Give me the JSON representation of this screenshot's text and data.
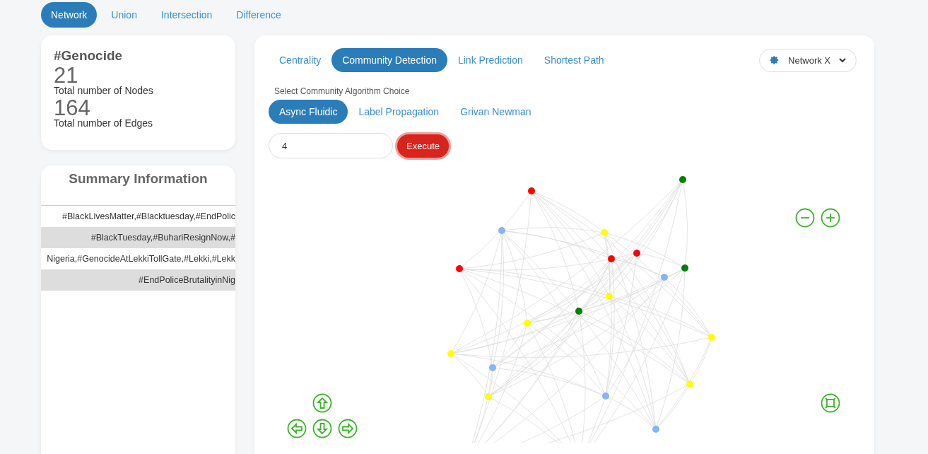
{
  "top_tabs": [
    {
      "label": "Network",
      "selected": true
    },
    {
      "label": "Union",
      "selected": false
    },
    {
      "label": "Intersection",
      "selected": false
    },
    {
      "label": "Difference",
      "selected": false
    }
  ],
  "stats": {
    "title": "#Genocide",
    "nodes_count": "21",
    "nodes_label": "Total number of Nodes",
    "edges_count": "164",
    "edges_label": "Total number of Edges"
  },
  "summary": {
    "title": "Summary Information",
    "rows": [
      {
        "text": "#BlackLivesMatter,#Blacktuesday,#EndPolic"
      },
      {
        "text": "#BlackTuesday,#BuhariResignNow,#"
      },
      {
        "text": "Nigeria,#GenocideAtLekkiTollGate,#Lekki,#Lekk"
      },
      {
        "text": "#EndPoliceBrutalityinNig"
      }
    ]
  },
  "analysis_tabs": [
    {
      "label": "Centrality",
      "selected": false
    },
    {
      "label": "Community Detection",
      "selected": true
    },
    {
      "label": "Link Prediction",
      "selected": false
    },
    {
      "label": "Shortest Path",
      "selected": false
    }
  ],
  "engine_select": {
    "value": "Network X"
  },
  "algorithm": {
    "label": "Select Community Algorithm Choice",
    "options": [
      {
        "label": "Async Fluidic",
        "selected": true
      },
      {
        "label": "Label Propagation",
        "selected": false
      },
      {
        "label": "Grivan Newman",
        "selected": false
      }
    ]
  },
  "communities_input": {
    "value": "4"
  },
  "execute_button": {
    "label": "Execute"
  },
  "graph": {
    "nodes": [
      {
        "color": "#ff0000"
      },
      {
        "color": "#008000"
      },
      {
        "color": "#87b4f5"
      },
      {
        "color": "#ffff00"
      },
      {
        "color": "#ff0000"
      },
      {
        "color": "#ff0000"
      },
      {
        "color": "#ff0000"
      },
      {
        "color": "#008000"
      },
      {
        "color": "#87b4f5"
      },
      {
        "color": "#ffff00"
      },
      {
        "color": "#008000"
      },
      {
        "color": "#ffff00"
      },
      {
        "color": "#ffff00"
      },
      {
        "color": "#ffff00"
      },
      {
        "color": "#87b4f5"
      },
      {
        "color": "#ffff00"
      },
      {
        "color": "#ffff00"
      },
      {
        "color": "#87b4f5"
      },
      {
        "color": "#87b4f5"
      }
    ]
  }
}
